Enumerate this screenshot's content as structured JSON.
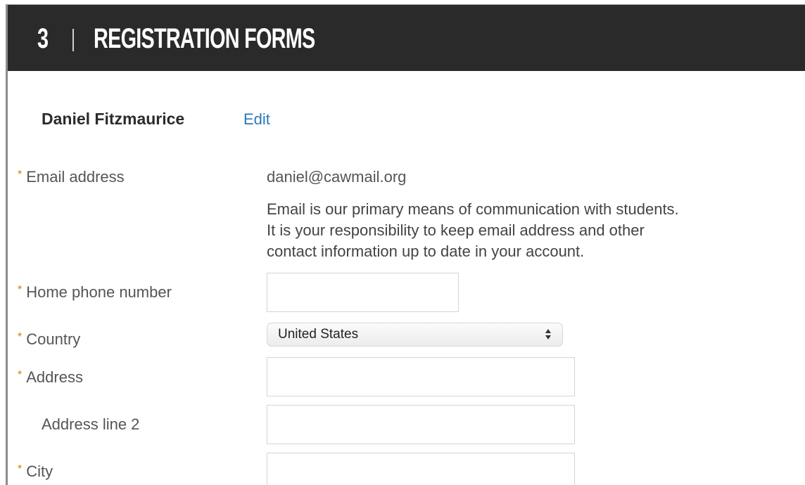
{
  "header": {
    "step_number": "3",
    "title": "REGISTRATION FORMS"
  },
  "user": {
    "name": "Daniel Fitzmaurice",
    "edit_label": "Edit"
  },
  "form": {
    "required_marker": "*",
    "email": {
      "label": "Email address",
      "value": "daniel@cawmail.org",
      "help_lines": [
        "Email is our primary means of communication with students.",
        "It is your responsibility to keep email address and other",
        "contact information up to date in your account."
      ]
    },
    "home_phone": {
      "label": "Home phone number",
      "value": ""
    },
    "country": {
      "label": "Country",
      "selected": "United States"
    },
    "address": {
      "label": "Address",
      "value": ""
    },
    "address_line2": {
      "label": "Address line 2",
      "value": ""
    },
    "city": {
      "label": "City",
      "value": ""
    }
  },
  "colors": {
    "header_background": "#2a2a2a",
    "link": "#2a7ab8",
    "required_marker": "#e07b00"
  }
}
